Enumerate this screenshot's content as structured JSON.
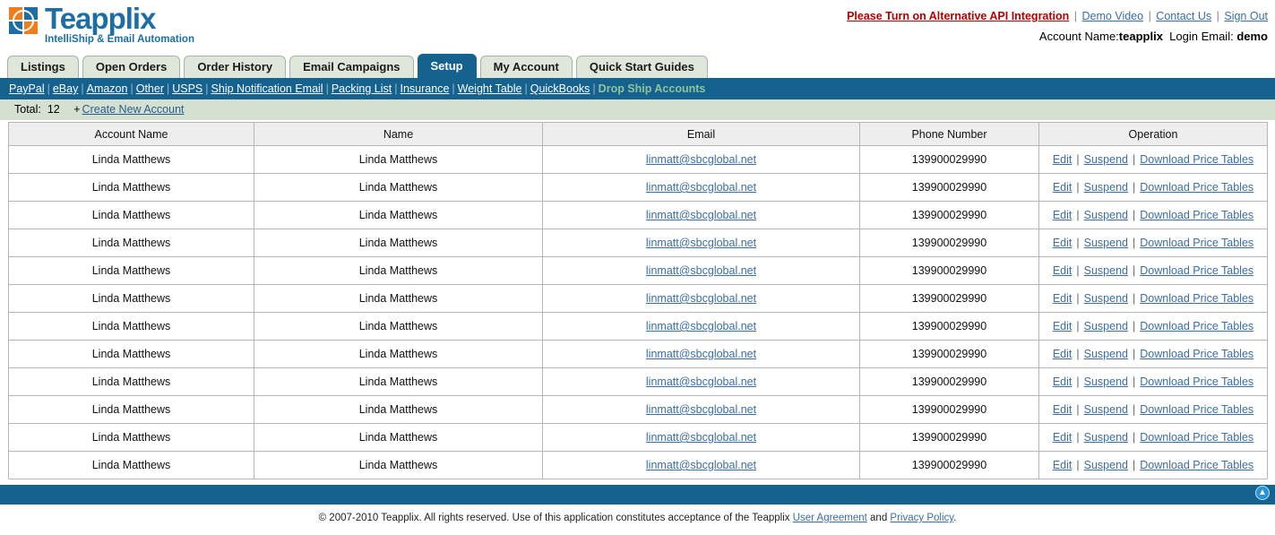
{
  "brand": {
    "name": "Teapplix",
    "tagline": "IntelliShip & Email Automation"
  },
  "header": {
    "alert_link": "Please Turn on Alternative API Integration",
    "links": [
      "Demo Video",
      "Contact Us",
      "Sign Out"
    ],
    "separator": "|",
    "account_label": "Account Name:",
    "account_value": "teapplix",
    "login_label": "Login Email:",
    "login_value": "demo"
  },
  "tabs": [
    {
      "label": "Listings",
      "active": false
    },
    {
      "label": "Open Orders",
      "active": false
    },
    {
      "label": "Order History",
      "active": false
    },
    {
      "label": "Email Campaigns",
      "active": false
    },
    {
      "label": "Setup",
      "active": true
    },
    {
      "label": "My Account",
      "active": false
    },
    {
      "label": "Quick Start Guides",
      "active": false
    }
  ],
  "subnav": {
    "items": [
      {
        "label": "PayPal",
        "current": false
      },
      {
        "label": "eBay",
        "current": false
      },
      {
        "label": "Amazon",
        "current": false
      },
      {
        "label": "Other",
        "current": false
      },
      {
        "label": "USPS",
        "current": false
      },
      {
        "label": "Ship Notification Email",
        "current": false
      },
      {
        "label": "Packing List",
        "current": false
      },
      {
        "label": "Insurance",
        "current": false
      },
      {
        "label": "Weight Table",
        "current": false
      },
      {
        "label": "QuickBooks",
        "current": false
      },
      {
        "label": "Drop Ship Accounts",
        "current": true
      }
    ],
    "separator": "|",
    "active_color": "#8fc49b"
  },
  "toolbar": {
    "total_label": "Total:",
    "total_count": "12",
    "plus": "+",
    "create_label": "Create New Account"
  },
  "table": {
    "columns": [
      "Account  Name",
      "Name",
      "Email",
      "Phone Number",
      "Operation"
    ],
    "operations": [
      "Edit",
      "Suspend",
      "Download Price Tables"
    ],
    "op_separator": "|",
    "rows": [
      {
        "account_name": "Linda Matthews",
        "name": "Linda Matthews",
        "email": "linmatt@sbcglobal.net",
        "phone": "139900029990"
      },
      {
        "account_name": "Linda Matthews",
        "name": "Linda Matthews",
        "email": "linmatt@sbcglobal.net",
        "phone": "139900029990"
      },
      {
        "account_name": "Linda Matthews",
        "name": "Linda Matthews",
        "email": "linmatt@sbcglobal.net",
        "phone": "139900029990"
      },
      {
        "account_name": "Linda Matthews",
        "name": "Linda Matthews",
        "email": "linmatt@sbcglobal.net",
        "phone": "139900029990"
      },
      {
        "account_name": "Linda Matthews",
        "name": "Linda Matthews",
        "email": "linmatt@sbcglobal.net",
        "phone": "139900029990"
      },
      {
        "account_name": "Linda Matthews",
        "name": "Linda Matthews",
        "email": "linmatt@sbcglobal.net",
        "phone": "139900029990"
      },
      {
        "account_name": "Linda Matthews",
        "name": "Linda Matthews",
        "email": "linmatt@sbcglobal.net",
        "phone": "139900029990"
      },
      {
        "account_name": "Linda Matthews",
        "name": "Linda Matthews",
        "email": "linmatt@sbcglobal.net",
        "phone": "139900029990"
      },
      {
        "account_name": "Linda Matthews",
        "name": "Linda Matthews",
        "email": "linmatt@sbcglobal.net",
        "phone": "139900029990"
      },
      {
        "account_name": "Linda Matthews",
        "name": "Linda Matthews",
        "email": "linmatt@sbcglobal.net",
        "phone": "139900029990"
      },
      {
        "account_name": "Linda Matthews",
        "name": "Linda Matthews",
        "email": "linmatt@sbcglobal.net",
        "phone": "139900029990"
      },
      {
        "account_name": "Linda Matthews",
        "name": "Linda Matthews",
        "email": "linmatt@sbcglobal.net",
        "phone": "139900029990"
      }
    ]
  },
  "footer": {
    "text_before": "© 2007-2010 Teapplix. All rights reserved. Use of this application constitutes acceptance of the Teapplix",
    "user_agreement": "User Agreement",
    "and": "and",
    "privacy_policy": "Privacy Policy",
    "period": ".",
    "scroll_top_icon": "arrow-up-icon"
  },
  "colors": {
    "brand_blue": "#15628f",
    "brand_orange": "#ef7d1a",
    "tab_inactive": "#dfe7da",
    "total_bar": "#d5e0d0",
    "alert_red": "#b40000"
  }
}
